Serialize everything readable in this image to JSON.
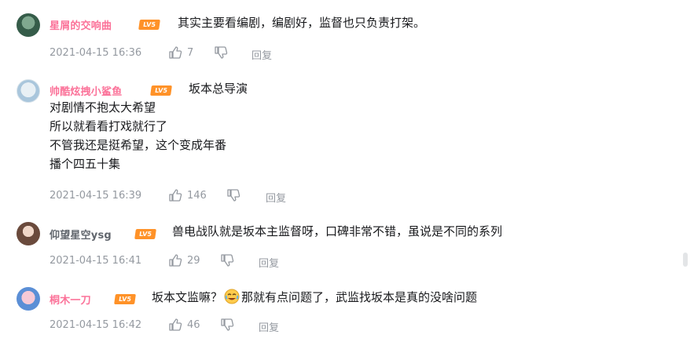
{
  "comments": [
    {
      "username": "星屑的交响曲",
      "level": "LV5",
      "content_lines": [
        "其实主要看编剧，编剧好，监督也只负责打架。"
      ],
      "date": "2021-04-15 16:36",
      "likes": "7",
      "reply_label": "回复"
    },
    {
      "username": "帅酷炫拽小鲨鱼",
      "level": "LV5",
      "content_lines": [
        "坂本总导演",
        "对剧情不抱太大希望",
        "所以就看看打戏就行了",
        "不管我还是挺希望，这个变成年番",
        "播个四五十集"
      ],
      "date": "2021-04-15 16:39",
      "likes": "146",
      "reply_label": "回复"
    },
    {
      "username": "仰望星空ysg",
      "level": "LV5",
      "content_lines": [
        "兽电战队就是坂本主监督呀，口碑非常不错，虽说是不同的系列"
      ],
      "date": "2021-04-15 16:41",
      "likes": "29",
      "reply_label": "回复"
    },
    {
      "username": "桐木一刀",
      "level": "LV5",
      "content_before": "坂本文监嘛？",
      "content_after": "那就有点问题了，武监找坂本是真的没啥问题",
      "emoji": "laughing-tears-emoji",
      "date": "2021-04-15 16:42",
      "likes": "46",
      "reply_label": "回复"
    }
  ],
  "colors": {
    "username_pink": "#fb7299",
    "username_gray": "#61666d",
    "level_badge": "#ff9228",
    "meta_gray": "#9499a0",
    "text": "#18191c"
  }
}
